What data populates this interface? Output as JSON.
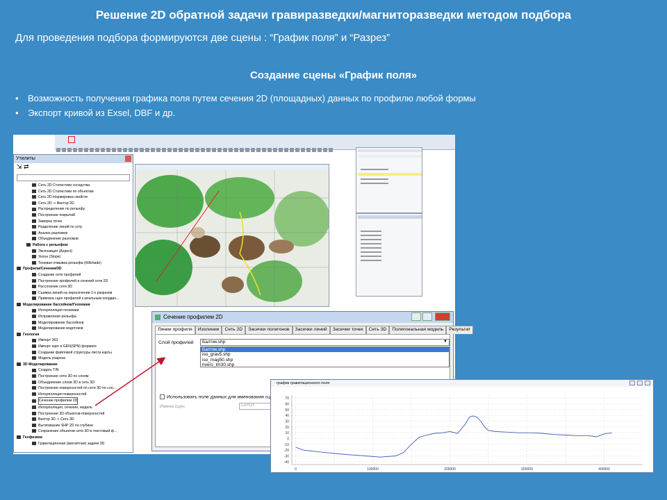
{
  "slide": {
    "title": "Решение 2D обратной задачи гравиразведки/магниторазведки  методом подбора",
    "subtitle": "Для проведения подбора формируются две сцены : “График поля” и “Разрез”",
    "section": "Создание сцены «График поля»",
    "bullets": [
      "Возможность получения графика поля путем сечения 2D (площадных) данных по профилю  любой формы",
      "Экспорт кривой из Exsel, DBF и др."
    ]
  },
  "utilities": {
    "title": "Утилиты",
    "items": [
      {
        "text": "Сеть 2D Статистики соседства",
        "level": 2
      },
      {
        "text": "Сеть 2D Статистики по объектам",
        "level": 2
      },
      {
        "text": "Сеть 2D Нормировка свойств",
        "level": 2
      },
      {
        "text": "Сеть 2D ⇒ Вектор 2D",
        "level": 2
      },
      {
        "text": "Распределение по рельефу",
        "level": 2
      },
      {
        "text": "Построение покрытий",
        "level": 2
      },
      {
        "text": "Заверка точек",
        "level": 2
      },
      {
        "text": "Разделение линий по углу",
        "level": 2
      },
      {
        "text": "Анализ разломов",
        "level": 2
      },
      {
        "text": "Объединение разломов",
        "level": 2
      },
      {
        "text": "Работа с рельефом",
        "level": 1,
        "cat": true
      },
      {
        "text": "Экспозиция (Aspect)",
        "level": 2
      },
      {
        "text": "Уклон (Slope)",
        "level": 2
      },
      {
        "text": "Теневая отмывка рельефа (Hillshade)",
        "level": 2
      },
      {
        "text": "Профили/Сечения/3D",
        "level": 0,
        "cat": true
      },
      {
        "text": "Создание сети профилей",
        "level": 2
      },
      {
        "text": "Построение профилей и сечений сети 2D",
        "level": 2
      },
      {
        "text": "Расслоение сети 3D",
        "level": 2
      },
      {
        "text": "Сшивка линий на пересечении 2-х разрезов",
        "level": 2
      },
      {
        "text": "Привязка сцен профилей к реальным координ...",
        "level": 2
      },
      {
        "text": "Моделирование бассейнов/Геохимия",
        "level": 0,
        "cat": true
      },
      {
        "text": "Интерполяция геохимии",
        "level": 2
      },
      {
        "text": "Исправление рельефа",
        "level": 2
      },
      {
        "text": "Моделирование бассейнов",
        "level": 2
      },
      {
        "text": "Моделирование водотоков",
        "level": 2
      },
      {
        "text": "Геология",
        "level": 0,
        "cat": true
      },
      {
        "text": "Импорт 363",
        "level": 2
      },
      {
        "text": "Импорт карт в GEN(SPN) формате",
        "level": 2
      },
      {
        "text": "Создание файловой структуры листа карты",
        "level": 2
      },
      {
        "text": "Модель разреза",
        "level": 2
      },
      {
        "text": "3D Моделирование",
        "level": 0,
        "cat": true
      },
      {
        "text": "Создать TIN",
        "level": 2
      },
      {
        "text": "Построение сети 3D по слоям",
        "level": 2
      },
      {
        "text": "Объединение слоев 3D в сеть 3D",
        "level": 2
      },
      {
        "text": "Построение поверхностей по сети 3D по сло...",
        "level": 2
      },
      {
        "text": "Интерполяция поверхностей",
        "level": 2
      },
      {
        "text": "Сечение профилем 2D",
        "level": 2,
        "selected": true
      },
      {
        "text": "Интерполяция, сечение, модель",
        "level": 2
      },
      {
        "text": "Построение 3D объектов-поверхностей",
        "level": 2
      },
      {
        "text": "Вектор 3D ⇒ Сеть 3D",
        "level": 2
      },
      {
        "text": "Вытягивание SHP 2D по глубине",
        "level": 2
      },
      {
        "text": "Сохранение объектов сети 3D в текстовый ф...",
        "level": 2
      },
      {
        "text": "Геофизика",
        "level": 0,
        "cat": true
      },
      {
        "text": "Гравитационная (магнитная) задачи 3D",
        "level": 2
      }
    ]
  },
  "dialog": {
    "title": "Сечение профилем 2D",
    "tabs": [
      "Линии профиля",
      "Изолинии",
      "Сеть 2D",
      "Засечки полигонов",
      "Засечки линий",
      "Засечки точек",
      "Сеть 3D",
      "Полигональная модель",
      "Результат"
    ],
    "layer_label": "Слой профилей",
    "layer_value": "Балтик.shp",
    "layer_options": [
      "Балтик.shp",
      "iso_grav5.shp",
      "iso_mag50.shp",
      "rivers_tm30.shp"
    ],
    "checkbox_label": "Использовать поле данных для именования сцен",
    "scene_name_label": "Имена сцен",
    "scene_field": "LAYER"
  },
  "graph": {
    "title": "график гравитационного поля"
  },
  "chart_data": {
    "type": "line",
    "title": "",
    "xlabel": "",
    "ylabel": "",
    "x_ticks": [
      0,
      50000,
      100000,
      150000,
      200000,
      250000,
      300000,
      350000,
      400000
    ],
    "x_tick_labels": [
      "0",
      "",
      "100000",
      "",
      "200000",
      "",
      "300000",
      "",
      "400000"
    ],
    "y_ticks": [
      70,
      60,
      50,
      40,
      30,
      20,
      10,
      0,
      -10,
      -20,
      -30,
      -40
    ],
    "xlim": [
      -5000,
      450000
    ],
    "ylim": [
      -45,
      75
    ],
    "grid": true,
    "series": [
      {
        "x": [
          0,
          10000,
          30000,
          60000,
          90000,
          110000,
          130000,
          140000,
          150000,
          160000,
          170000,
          180000,
          190000,
          200000,
          210000,
          220000,
          225000,
          230000,
          235000,
          240000,
          245000,
          250000,
          260000,
          275000,
          290000,
          305000,
          320000,
          335000,
          350000,
          365000,
          380000,
          390000,
          400000,
          410000
        ],
        "y": [
          -15,
          -20,
          -23,
          -27,
          -30,
          -32,
          -30,
          -24,
          -10,
          2,
          6,
          9,
          10,
          12,
          9,
          25,
          37,
          39,
          37,
          30,
          20,
          14,
          12,
          11,
          10,
          10,
          9,
          7,
          6,
          5,
          5,
          3,
          8,
          10
        ]
      }
    ]
  }
}
